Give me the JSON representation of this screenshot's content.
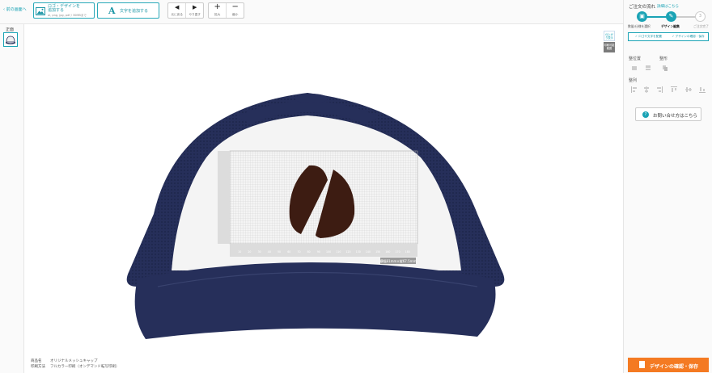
{
  "toolbar": {
    "back_label": "前の画面へ",
    "logo_button": {
      "line1": "ロゴ・デザインを",
      "line2": "追加する",
      "formats": "ai, png, jpg, pdf / 30MBまで"
    },
    "text_button": {
      "icon_glyph": "A",
      "label": "文字を追加する"
    },
    "undo": {
      "glyph": "◀",
      "label": "元に戻る"
    },
    "redo": {
      "glyph": "▶",
      "label": "やり直す"
    },
    "zoom_in": {
      "glyph": "+",
      "label": "拡大"
    },
    "zoom_out": {
      "glyph": "−",
      "label": "縮小"
    }
  },
  "left_sidebar": {
    "label": "正面"
  },
  "canvas": {
    "view_toggles": [
      {
        "label": "仕上がり表示"
      },
      {
        "label": "印刷可能範囲"
      }
    ],
    "ruler_x_ticks": [
      "10",
      "20",
      "30",
      "40",
      "50",
      "60",
      "70",
      "80",
      "90",
      "100",
      "110",
      "120",
      "130",
      "140",
      "150",
      "160",
      "170",
      "180"
    ],
    "size_label": "横幅81mm×縦67.5mm",
    "product_info": {
      "name_key": "商品名",
      "name_value": "オリジナルメッシュキャップ",
      "method_key": "印刷方法",
      "method_value": "フルカラー印刷（オンデマンド転写印刷）"
    },
    "colors": {
      "cap_navy": "#262f5a",
      "cap_white": "#f4f4f4",
      "bean": "#3d1c12",
      "accent": "#1aa3b5"
    }
  },
  "right_panel": {
    "title": "ご注文の流れ",
    "details_link": "詳細はこちら",
    "steps": [
      {
        "label": "数量/仕様を選択",
        "icon": "bag-icon",
        "status": "done"
      },
      {
        "label": "デザイン編集",
        "icon": "pencil-icon",
        "status": "current"
      },
      {
        "label": "ご注文完了",
        "icon": "3",
        "status": "todo"
      }
    ],
    "sub_tabs": [
      "✓ ロゴや文字を配置",
      "✓ デザインの確認・保存"
    ],
    "arrange_label": "整位置",
    "group_label": "整形",
    "align_label": "整列",
    "help_button": "お問い合せ方はこちら",
    "save_button": "デザインの確認・保存"
  }
}
